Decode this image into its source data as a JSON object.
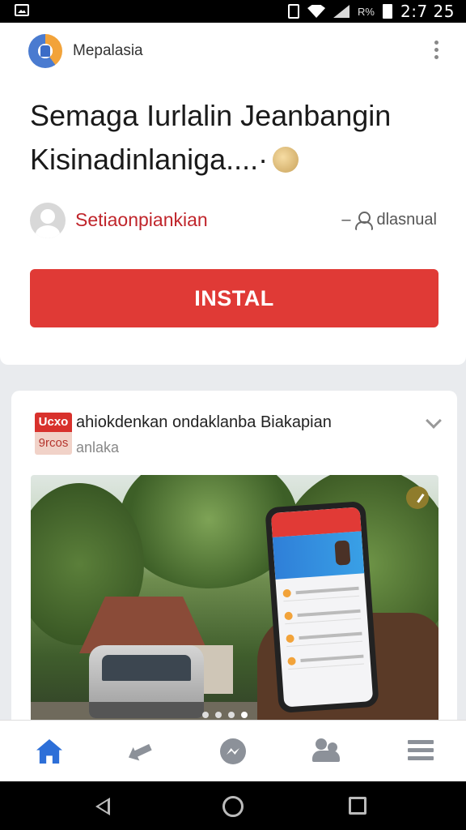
{
  "status_bar": {
    "signal_text": "R%",
    "time": "2:7 25"
  },
  "app_card": {
    "app_name": "Mepalasia",
    "headline_line1": "Semaga Iurlalin Jeanbangin",
    "headline_line2": "Kisinadinlaniga....·",
    "author_name": "Setiaonpiankian",
    "author_meta_prefix": "–",
    "author_meta": "dlasnual",
    "install_label": "INSTAL"
  },
  "post": {
    "badge_top": "Ucxo",
    "badge_bottom": "9rcos",
    "title": "ahiokdenkan ondaklanba Biakapian",
    "subtitle": "anlaka",
    "carousel_count": 4,
    "carousel_active": 4
  },
  "colors": {
    "accent_red": "#e03a36",
    "author_red": "#c0252b",
    "nav_active_blue": "#2d6fd8"
  },
  "bottom_nav": {
    "active": "home",
    "items": [
      "home-icon",
      "share-icon",
      "messenger-icon",
      "friends-icon",
      "menu-icon"
    ]
  }
}
